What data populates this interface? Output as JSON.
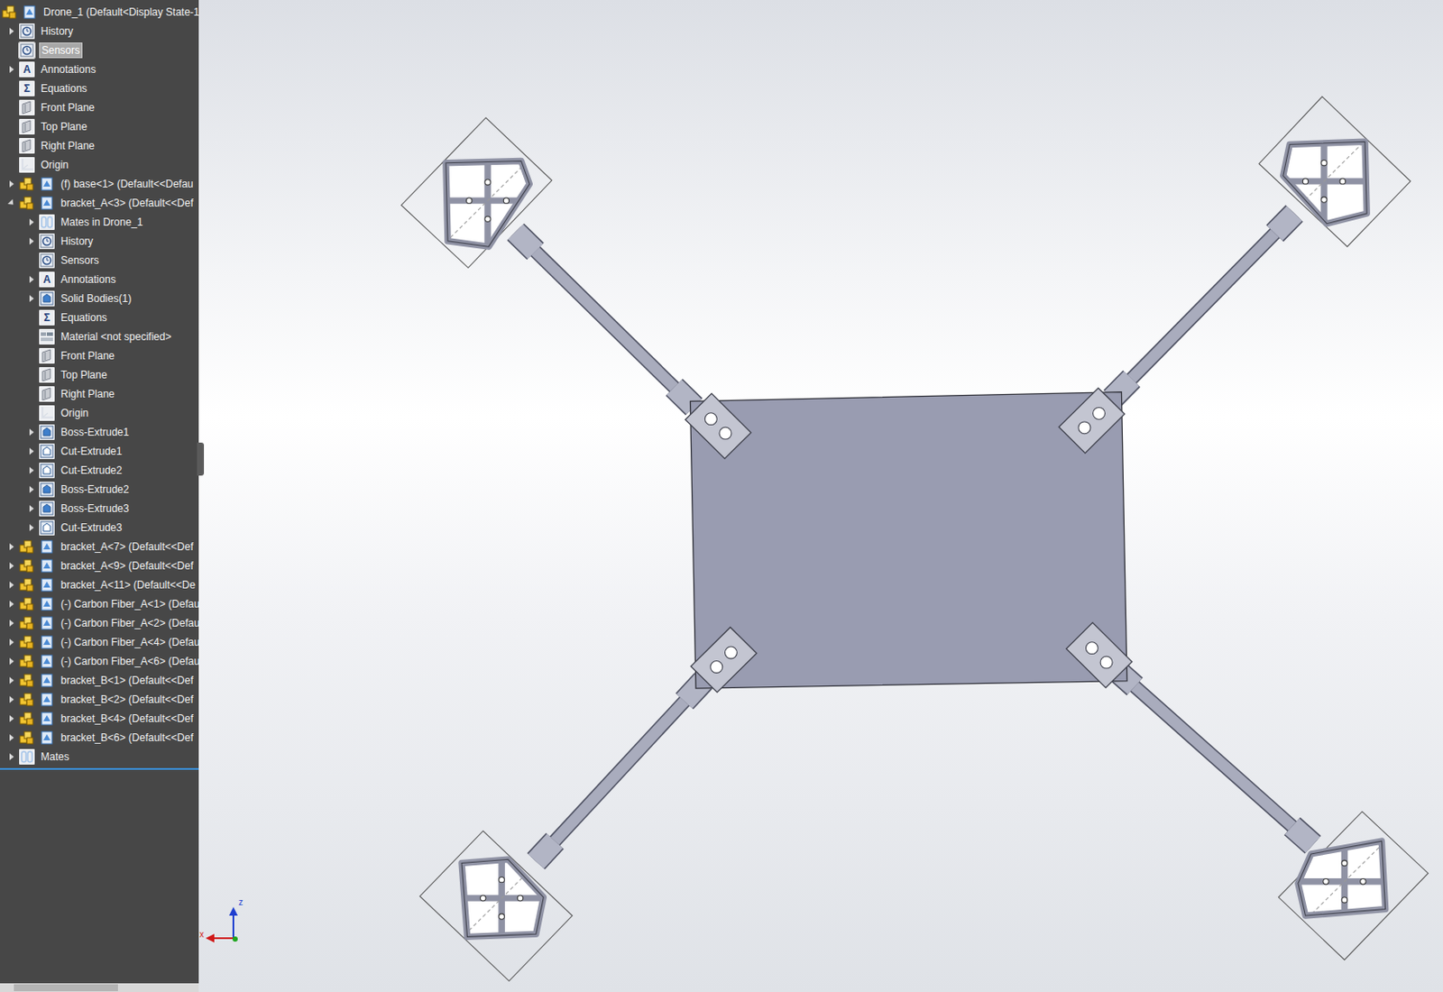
{
  "tree": {
    "items": [
      {
        "label": "Drone_1  (Default<Display State-1",
        "level": 0,
        "kind": "root",
        "expandable": false,
        "expanded": false,
        "selected": false
      },
      {
        "label": "History",
        "level": 0,
        "kind": "history",
        "expandable": true,
        "expanded": false,
        "selected": false
      },
      {
        "label": "Sensors",
        "level": 0,
        "kind": "sensors",
        "expandable": false,
        "expanded": false,
        "selected": true
      },
      {
        "label": "Annotations",
        "level": 0,
        "kind": "annotations",
        "glyph": "A",
        "expandable": true,
        "expanded": false,
        "selected": false
      },
      {
        "label": "Equations",
        "level": 0,
        "kind": "equations",
        "glyph": "Σ",
        "expandable": false,
        "expanded": false,
        "selected": false
      },
      {
        "label": "Front Plane",
        "level": 0,
        "kind": "plane",
        "expandable": false,
        "expanded": false,
        "selected": false
      },
      {
        "label": "Top Plane",
        "level": 0,
        "kind": "plane",
        "expandable": false,
        "expanded": false,
        "selected": false
      },
      {
        "label": "Right Plane",
        "level": 0,
        "kind": "plane",
        "expandable": false,
        "expanded": false,
        "selected": false
      },
      {
        "label": "Origin",
        "level": 0,
        "kind": "origin",
        "expandable": false,
        "expanded": false,
        "selected": false
      },
      {
        "label": "(f) base<1> (Default<<Defau",
        "level": 0,
        "kind": "component",
        "expandable": true,
        "expanded": false,
        "selected": false
      },
      {
        "label": "bracket_A<3> (Default<<Def",
        "level": 0,
        "kind": "component",
        "expandable": true,
        "expanded": true,
        "selected": false
      },
      {
        "label": "Mates in Drone_1",
        "level": 1,
        "kind": "mates-folder",
        "expandable": true,
        "expanded": false,
        "selected": false
      },
      {
        "label": "History",
        "level": 1,
        "kind": "history",
        "expandable": true,
        "expanded": false,
        "selected": false
      },
      {
        "label": "Sensors",
        "level": 1,
        "kind": "sensors",
        "expandable": false,
        "expanded": false,
        "selected": false
      },
      {
        "label": "Annotations",
        "level": 1,
        "kind": "annotations",
        "glyph": "A",
        "expandable": true,
        "expanded": false,
        "selected": false
      },
      {
        "label": "Solid Bodies(1)",
        "level": 1,
        "kind": "bodies",
        "expandable": true,
        "expanded": false,
        "selected": false
      },
      {
        "label": "Equations",
        "level": 1,
        "kind": "equations",
        "glyph": "Σ",
        "expandable": false,
        "expanded": false,
        "selected": false
      },
      {
        "label": "Material <not specified>",
        "level": 1,
        "kind": "material",
        "expandable": false,
        "expanded": false,
        "selected": false
      },
      {
        "label": "Front Plane",
        "level": 1,
        "kind": "plane",
        "expandable": false,
        "expanded": false,
        "selected": false
      },
      {
        "label": "Top Plane",
        "level": 1,
        "kind": "plane",
        "expandable": false,
        "expanded": false,
        "selected": false
      },
      {
        "label": "Right Plane",
        "level": 1,
        "kind": "plane",
        "expandable": false,
        "expanded": false,
        "selected": false
      },
      {
        "label": "Origin",
        "level": 1,
        "kind": "origin",
        "expandable": false,
        "expanded": false,
        "selected": false
      },
      {
        "label": "Boss-Extrude1",
        "level": 1,
        "kind": "boss",
        "expandable": true,
        "expanded": false,
        "selected": false
      },
      {
        "label": "Cut-Extrude1",
        "level": 1,
        "kind": "cut",
        "expandable": true,
        "expanded": false,
        "selected": false
      },
      {
        "label": "Cut-Extrude2",
        "level": 1,
        "kind": "cut",
        "expandable": true,
        "expanded": false,
        "selected": false
      },
      {
        "label": "Boss-Extrude2",
        "level": 1,
        "kind": "boss",
        "expandable": true,
        "expanded": false,
        "selected": false
      },
      {
        "label": "Boss-Extrude3",
        "level": 1,
        "kind": "boss",
        "expandable": true,
        "expanded": false,
        "selected": false
      },
      {
        "label": "Cut-Extrude3",
        "level": 1,
        "kind": "cut",
        "expandable": true,
        "expanded": false,
        "selected": false
      },
      {
        "label": "bracket_A<7> (Default<<Def",
        "level": 0,
        "kind": "component",
        "expandable": true,
        "expanded": false,
        "selected": false
      },
      {
        "label": "bracket_A<9> (Default<<Def",
        "level": 0,
        "kind": "component",
        "expandable": true,
        "expanded": false,
        "selected": false
      },
      {
        "label": "bracket_A<11> (Default<<De",
        "level": 0,
        "kind": "component",
        "expandable": true,
        "expanded": false,
        "selected": false
      },
      {
        "label": "(-) Carbon Fiber_A<1> (Defau",
        "level": 0,
        "kind": "component",
        "expandable": true,
        "expanded": false,
        "selected": false
      },
      {
        "label": "(-) Carbon Fiber_A<2> (Defau",
        "level": 0,
        "kind": "component",
        "expandable": true,
        "expanded": false,
        "selected": false
      },
      {
        "label": "(-) Carbon Fiber_A<4> (Defau",
        "level": 0,
        "kind": "component",
        "expandable": true,
        "expanded": false,
        "selected": false
      },
      {
        "label": "(-) Carbon Fiber_A<6> (Defau",
        "level": 0,
        "kind": "component",
        "expandable": true,
        "expanded": false,
        "selected": false
      },
      {
        "label": "bracket_B<1> (Default<<Def",
        "level": 0,
        "kind": "component",
        "expandable": true,
        "expanded": false,
        "selected": false
      },
      {
        "label": "bracket_B<2> (Default<<Def",
        "level": 0,
        "kind": "component",
        "expandable": true,
        "expanded": false,
        "selected": false
      },
      {
        "label": "bracket_B<4> (Default<<Def",
        "level": 0,
        "kind": "component",
        "expandable": true,
        "expanded": false,
        "selected": false
      },
      {
        "label": "bracket_B<6> (Default<<Def",
        "level": 0,
        "kind": "component",
        "expandable": true,
        "expanded": false,
        "selected": false
      },
      {
        "label": "Mates",
        "level": 0,
        "kind": "mates",
        "expandable": true,
        "expanded": false,
        "selected": false
      }
    ]
  },
  "triad": {
    "axes": [
      {
        "label": "z"
      },
      {
        "label": "x"
      }
    ]
  }
}
